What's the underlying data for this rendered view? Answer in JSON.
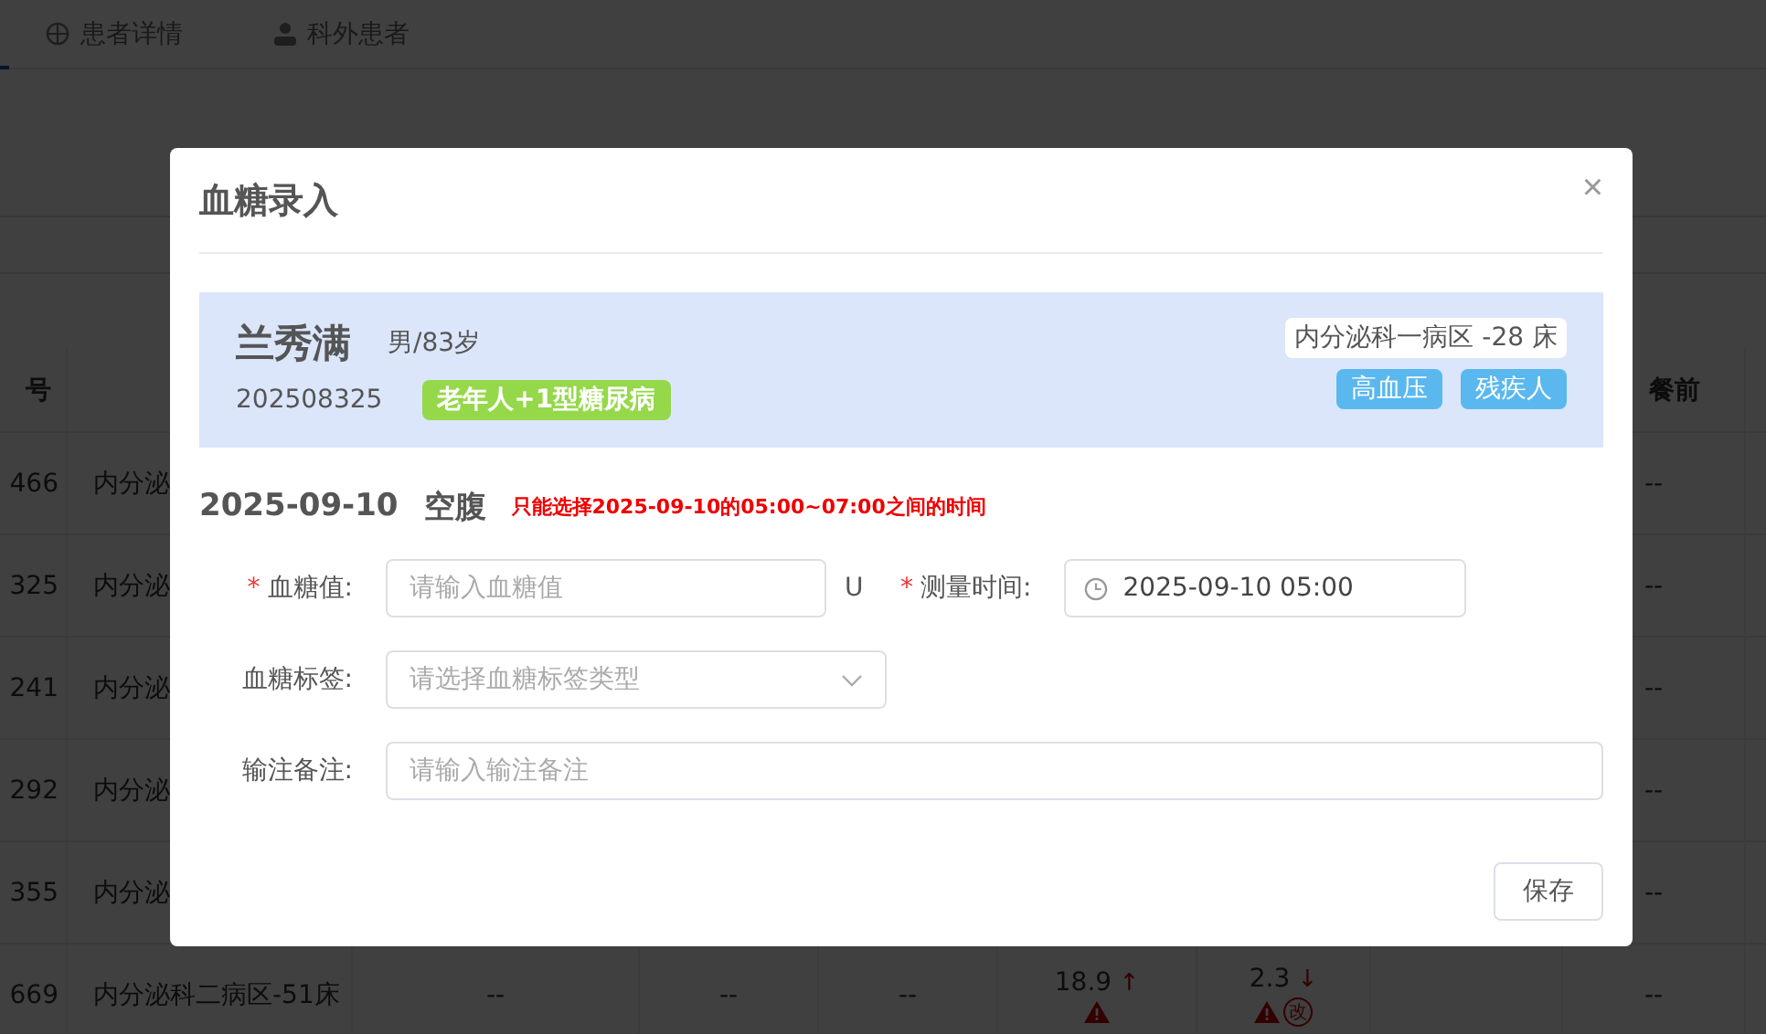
{
  "background": {
    "tabs": [
      {
        "label": "患者详情",
        "selected": false
      },
      {
        "label": "科外患者",
        "selected": false
      }
    ],
    "table": {
      "header": {
        "column_1": "号",
        "column_9": "餐前"
      },
      "rows": [
        {
          "column_1": "466",
          "column_2": "内分泌",
          "column_9": "--"
        },
        {
          "column_1": "325",
          "column_2": "内分泌",
          "column_9": "--"
        },
        {
          "column_1": "241",
          "column_2": "内分泌",
          "column_9": "--"
        },
        {
          "column_1": "292",
          "column_2": "内分泌",
          "column_9": "--"
        },
        {
          "column_1": "355",
          "column_2": "内分泌",
          "column_9": "--"
        },
        {
          "column_1": "669",
          "column_2": "内分泌科二病区-51床",
          "column_3": "--",
          "column_4": "--",
          "column_5": "--",
          "column_6": {
            "value": "18.9",
            "trend": "↑",
            "warning": true
          },
          "column_7": {
            "value": "2.3",
            "trend": "↓",
            "warning": true,
            "changed_mark": "改"
          },
          "column_9": "--"
        }
      ]
    }
  },
  "dialog": {
    "title": "血糖录入",
    "close": "×",
    "patient": {
      "name": "兰秀满",
      "gender_age": "男/83岁",
      "id": "202508325",
      "tags": [
        {
          "label": "老年人+1型糖尿病",
          "color": "#95d84a"
        }
      ],
      "ward": "内分泌科一病区 -28 床",
      "conditions": [
        {
          "label": "高血压",
          "color": "#5ab8ef"
        },
        {
          "label": "残疾人",
          "color": "#5ab8ef"
        }
      ]
    },
    "date": "2025-09-10",
    "period": "空腹",
    "hint": "只能选择2025-09-10的05:00~07:00之间的时间",
    "fields": [
      {
        "kind": "input",
        "label": "血糖值:",
        "required_mark": "*",
        "placeholder": "请输入血糖值",
        "unit": "U",
        "extra": {
          "kind": "datetime",
          "label": "测量时间:",
          "required_mark": "*",
          "value": "2025-09-10 05:00"
        }
      },
      {
        "kind": "select",
        "label": "血糖标签:",
        "placeholder": "请选择血糖标签类型"
      },
      {
        "kind": "wide",
        "label": "输注备注:",
        "placeholder": "请输入输注备注"
      }
    ],
    "save": "保存"
  }
}
